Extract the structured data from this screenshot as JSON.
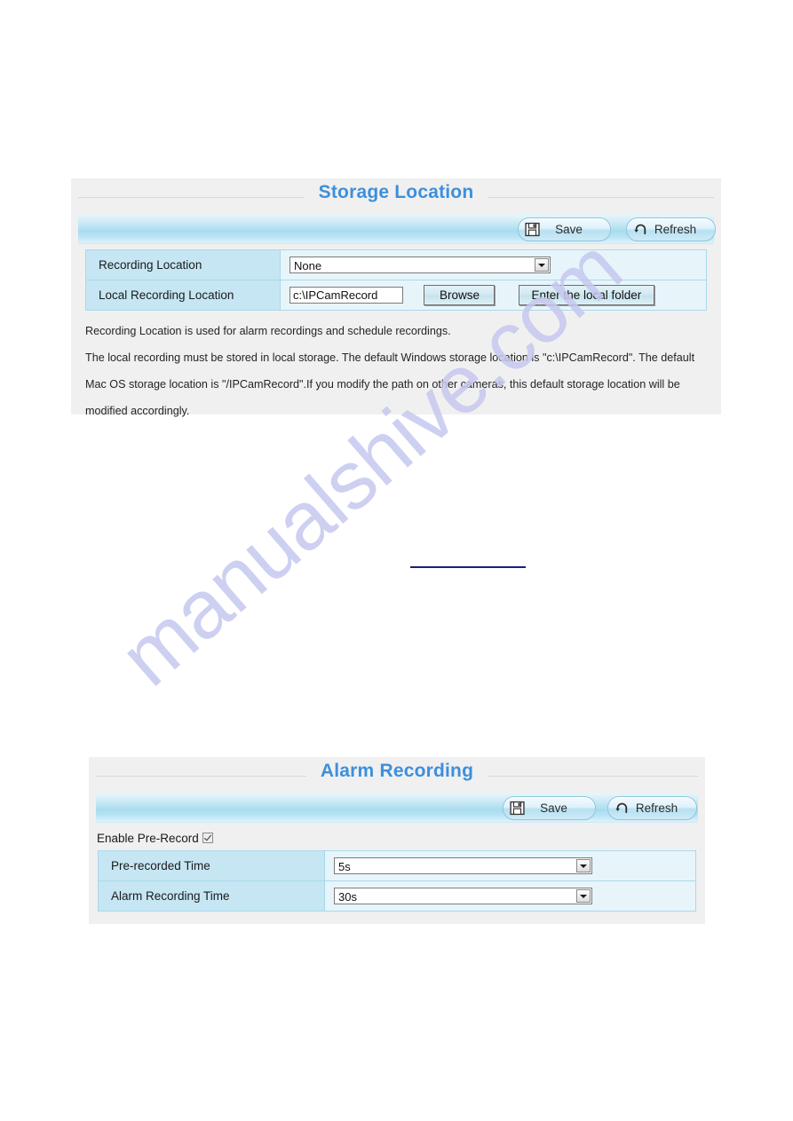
{
  "watermark": {
    "text": "manualshive.com"
  },
  "storage_panel": {
    "title": "Storage Location",
    "toolbar": {
      "save_label": "Save",
      "refresh_label": "Refresh",
      "save_icon": "floppy-disk-icon",
      "refresh_icon": "refresh-arrow-icon"
    },
    "rows": [
      {
        "label": "Recording Location",
        "control": "select",
        "value": "None"
      },
      {
        "label": "Local Recording Location",
        "control": "path",
        "value": "c:\\IPCamRecord",
        "browse_label": "Browse",
        "enter_folder_label": "Enter the local folder"
      }
    ],
    "description": [
      "Recording Location is used for alarm recordings and schedule recordings.",
      "The local recording must be stored in local storage. The default Windows storage location is \"c:\\IPCamRecord\". The default Mac OS storage location is \"/IPCamRecord\".If you modify the path on other cameras, this default storage location will be modified accordingly."
    ]
  },
  "alarm_panel": {
    "title": "Alarm Recording",
    "toolbar": {
      "save_label": "Save",
      "refresh_label": "Refresh",
      "save_icon": "floppy-disk-icon",
      "refresh_icon": "refresh-arrow-icon"
    },
    "enable_prerecord": {
      "label": "Enable Pre-Record",
      "checked": true
    },
    "rows": [
      {
        "label": "Pre-recorded Time",
        "control": "select",
        "value": "5s"
      },
      {
        "label": "Alarm Recording Time",
        "control": "select",
        "value": "30s"
      }
    ]
  },
  "colors": {
    "title_blue": "#3d8fdd",
    "label_cell": "#c6e6f4",
    "value_cell": "#e7f5fb",
    "panel_bg": "#f0f0f0",
    "rule_navy": "#1d1d7a",
    "watermark": "#c6c8ef"
  }
}
